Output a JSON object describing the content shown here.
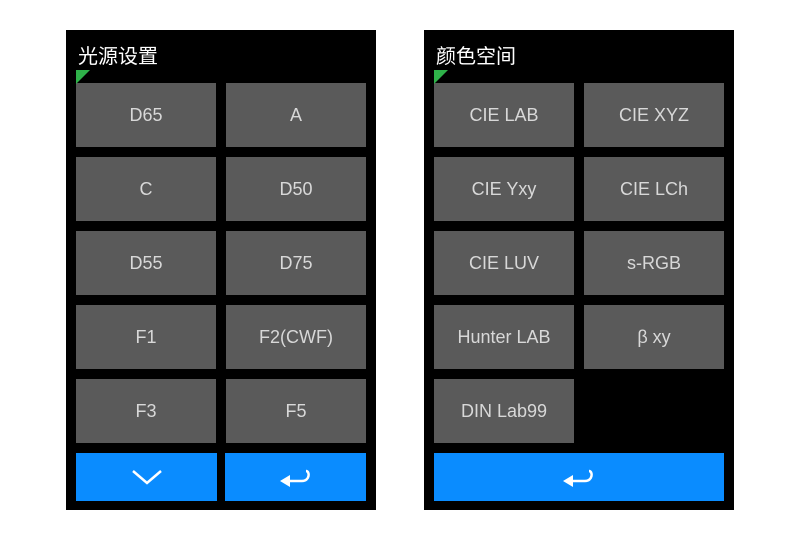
{
  "colors": {
    "screen_bg": "#000000",
    "button_bg": "#5a5a5a",
    "button_fg": "#d8d8d8",
    "accent": "#0a8cff",
    "marker": "#2fb24a",
    "title_fg": "#ffffff"
  },
  "left": {
    "title": "光源设置",
    "options": [
      "D65",
      "A",
      "C",
      "D50",
      "D55",
      "D75",
      "F1",
      "F2(CWF)",
      "F3",
      "F5"
    ],
    "footer": {
      "down_icon": "chevron-down",
      "back_icon": "return-arrow"
    }
  },
  "right": {
    "title": "颜色空间",
    "options": [
      "CIE LAB",
      "CIE XYZ",
      "CIE Yxy",
      "CIE LCh",
      "CIE LUV",
      "s-RGB",
      "Hunter LAB",
      "β xy",
      "DIN Lab99"
    ],
    "footer": {
      "back_icon": "return-arrow"
    }
  }
}
